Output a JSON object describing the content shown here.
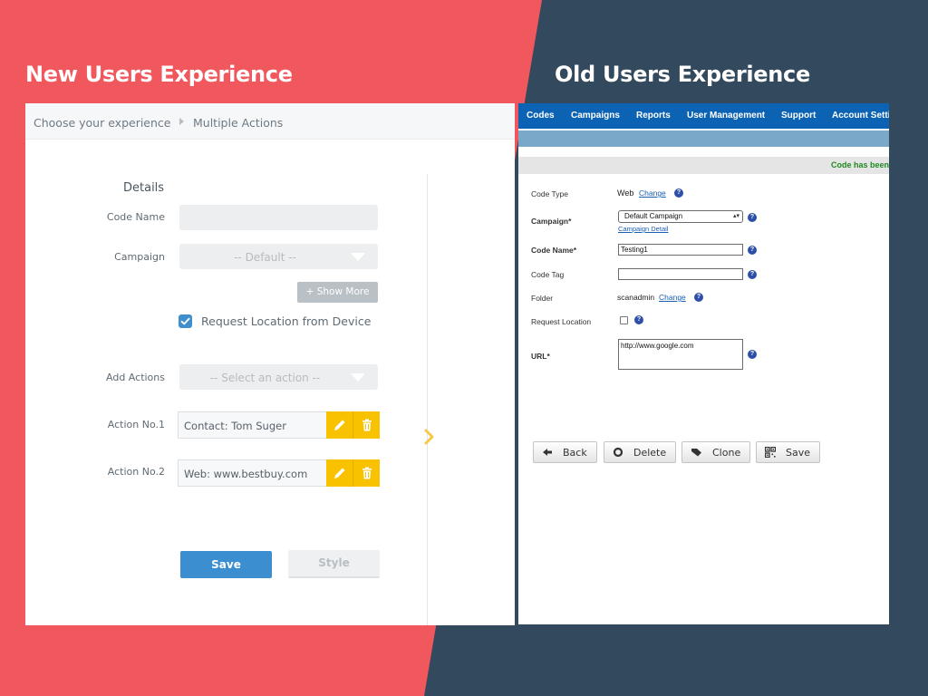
{
  "headings": {
    "new": "New Users Experience",
    "old": "Old Users Experience"
  },
  "colors": {
    "left_background": "#f0585e",
    "right_background": "#33495e",
    "accent_blue": "#3b8fd0",
    "action_yellow": "#f8c200",
    "old_nav_blue": "#0c63b3"
  },
  "new_ui": {
    "breadcrumb": [
      "Choose your experience",
      "Multiple Actions"
    ],
    "details_title": "Details",
    "labels": {
      "code_name": "Code Name",
      "campaign": "Campaign",
      "add_actions": "Add Actions",
      "action1": "Action No.1",
      "action2": "Action No.2"
    },
    "campaign_select": "-- Default --",
    "show_more": "+ Show More",
    "request_location": "Request Location from Device",
    "request_location_checked": true,
    "add_action_select": "--   Select an action   --",
    "actions": [
      "Contact: Tom Suger",
      "Web: www.bestbuy.com"
    ],
    "save": "Save",
    "style": "Style"
  },
  "old_ui": {
    "nav": [
      "Codes",
      "Campaigns",
      "Reports",
      "User Management",
      "Support",
      "Account Setti"
    ],
    "status": "Code has been",
    "labels": {
      "code_type": "Code Type",
      "campaign": "Campaign*",
      "code_name": "Code Name*",
      "code_tag": "Code Tag",
      "folder": "Folder",
      "request_location": "Request Location",
      "url": "URL*"
    },
    "code_type_value": "Web",
    "change": "Change",
    "campaign_value": "Default Campaign",
    "campaign_detail": "Campaign Detail",
    "code_name_value": "Testing1",
    "folder_value": "scanadmin",
    "url_value": "http://www.google.com",
    "buttons": [
      "Back",
      "Delete",
      "Clone",
      "Save"
    ]
  }
}
